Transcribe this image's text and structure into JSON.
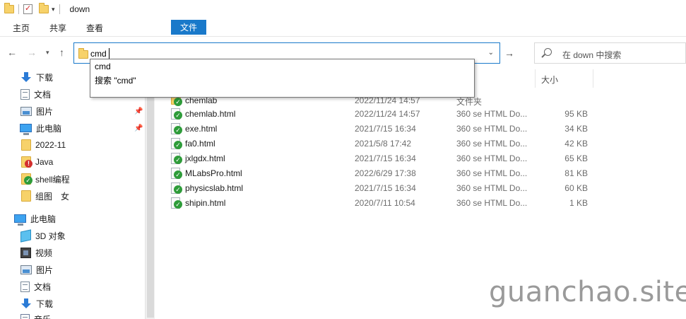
{
  "window": {
    "title": "down"
  },
  "ribbon": {
    "tabs": [
      "文件",
      "主页",
      "共享",
      "查看"
    ]
  },
  "address": {
    "value": "cmd",
    "search_placeholder": "在 down 中搜索"
  },
  "autocomplete": {
    "items": [
      "cmd",
      "搜索 \"cmd\""
    ]
  },
  "nav": {
    "quick_access": [
      {
        "label": "下载",
        "icon": "download-icon"
      },
      {
        "label": "文档",
        "icon": "document-icon"
      },
      {
        "label": "图片",
        "icon": "picture-icon",
        "pinned": true
      },
      {
        "label": "此电脑",
        "icon": "computer-icon",
        "pinned": true
      },
      {
        "label": "2022-11",
        "icon": "folder-icon"
      },
      {
        "label": "Java",
        "icon": "folder-error-icon"
      },
      {
        "label": "shell编程",
        "icon": "folder-sync-icon"
      },
      {
        "label": "组图　女",
        "icon": "folder-icon"
      }
    ],
    "this_pc": {
      "label": "此电脑",
      "icon": "computer-icon"
    },
    "pc_items": [
      {
        "label": "3D 对象",
        "icon": "3d-objects-icon"
      },
      {
        "label": "视频",
        "icon": "video-icon"
      },
      {
        "label": "图片",
        "icon": "picture-icon"
      },
      {
        "label": "文档",
        "icon": "document-icon"
      },
      {
        "label": "下载",
        "icon": "download-icon"
      },
      {
        "label": "音乐",
        "icon": "music-icon"
      }
    ]
  },
  "list": {
    "size_header": "大小",
    "files": [
      {
        "name": "chemlab",
        "date": "2022/11/24 14:57",
        "type": "文件夹",
        "size": "",
        "icon": "folder-sync-icon"
      },
      {
        "name": "chemlab.html",
        "date": "2022/11/24 14:57",
        "type": "360 se HTML Do...",
        "size": "95 KB",
        "icon": "html-file-icon"
      },
      {
        "name": "exe.html",
        "date": "2021/7/15 16:34",
        "type": "360 se HTML Do...",
        "size": "34 KB",
        "icon": "html-file-icon"
      },
      {
        "name": "fa0.html",
        "date": "2021/5/8 17:42",
        "type": "360 se HTML Do...",
        "size": "42 KB",
        "icon": "html-file-icon"
      },
      {
        "name": "jxlgdx.html",
        "date": "2021/7/15 16:34",
        "type": "360 se HTML Do...",
        "size": "65 KB",
        "icon": "html-file-icon"
      },
      {
        "name": "MLabsPro.html",
        "date": "2022/6/29 17:38",
        "type": "360 se HTML Do...",
        "size": "81 KB",
        "icon": "html-file-icon"
      },
      {
        "name": "physicslab.html",
        "date": "2021/7/15 16:34",
        "type": "360 se HTML Do...",
        "size": "60 KB",
        "icon": "html-file-icon"
      },
      {
        "name": "shipin.html",
        "date": "2020/7/11 10:54",
        "type": "360 se HTML Do...",
        "size": "1 KB",
        "icon": "html-file-icon"
      }
    ]
  },
  "watermark": "guanchao.site"
}
